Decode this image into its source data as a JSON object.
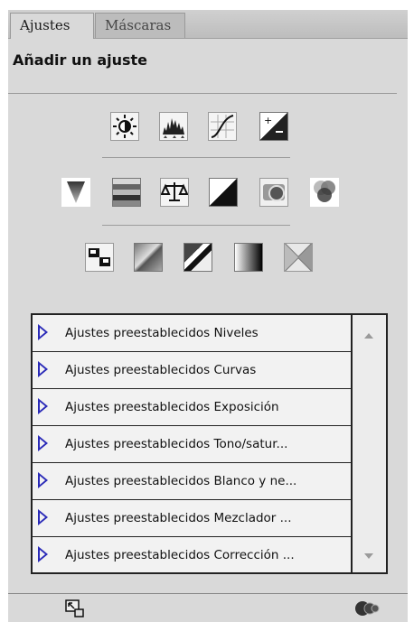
{
  "tabs": [
    "Ajustes",
    "Máscaras"
  ],
  "panel_title": "Añadir un ajuste",
  "icon_rows": [
    [
      "brightness-contrast-icon",
      "levels-icon",
      "curves-icon",
      "exposure-icon"
    ],
    [
      "vibrance-icon",
      "hue-saturation-icon",
      "color-balance-icon",
      "black-white-icon",
      "photo-filter-icon",
      "channel-mixer-icon"
    ],
    [
      "invert-icon",
      "posterize-icon",
      "threshold-icon",
      "gradient-map-icon",
      "selective-color-icon"
    ]
  ],
  "presets": [
    "Ajustes preestablecidos Niveles",
    "Ajustes preestablecidos Curvas",
    "Ajustes preestablecidos Exposición",
    "Ajustes preestablecidos Tono/satur...",
    "Ajustes preestablecidos Blanco y ne...",
    "Ajustes preestablecidos Mezclador ...",
    "Ajustes preestablecidos Corrección ..."
  ],
  "bottom_icons": [
    "return-to-list-icon",
    "clip-layer-icon"
  ],
  "colors": {
    "panel": "#d9d9d9",
    "triangle": "#2a2ab8"
  }
}
